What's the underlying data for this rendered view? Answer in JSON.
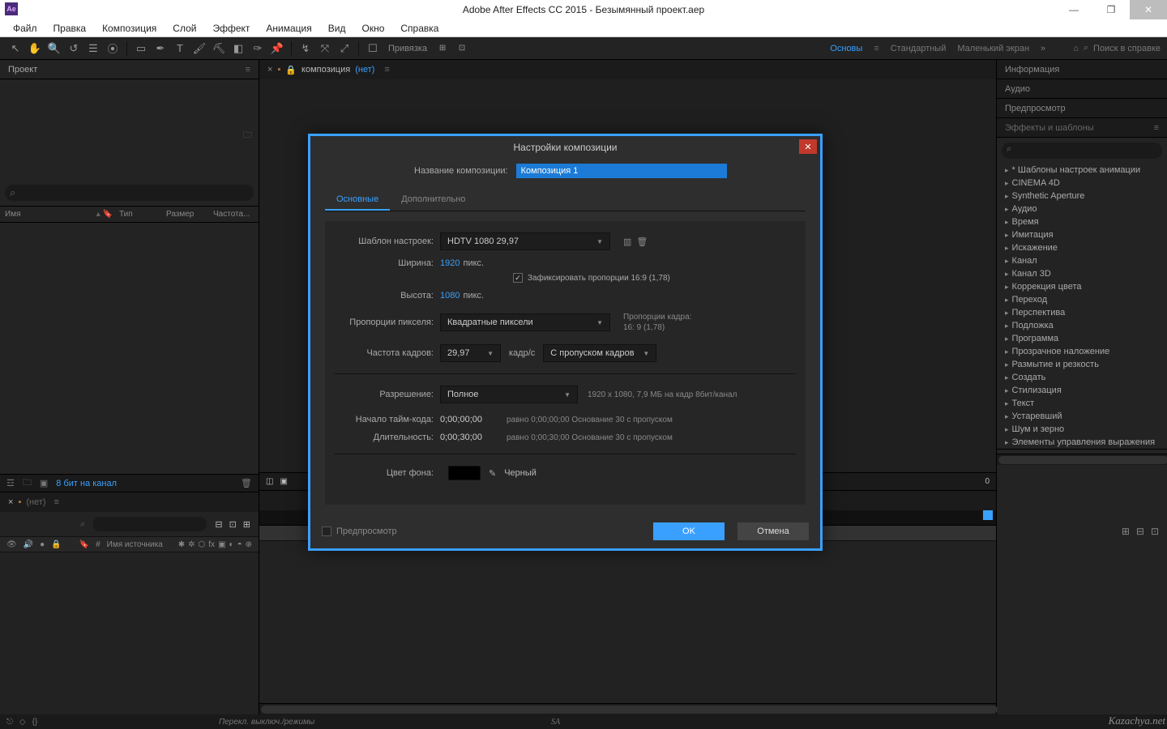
{
  "titlebar": {
    "title": "Adobe After Effects CC 2015 - Безымянный проект.aep",
    "icon_text": "Ae"
  },
  "menubar": [
    "Файл",
    "Правка",
    "Композиция",
    "Слой",
    "Эффект",
    "Анимация",
    "Вид",
    "Окно",
    "Справка"
  ],
  "toolbar": {
    "snap_label": "Привязка",
    "search_placeholder": "Поиск в справке"
  },
  "workspace": {
    "tabs": [
      "Основы",
      "Стандартный",
      "Маленький экран"
    ],
    "active": 0,
    "more": "»"
  },
  "project": {
    "title": "Проект",
    "cols": {
      "name": "Имя",
      "type": "Тип",
      "size": "Размер",
      "freq": "Частота..."
    },
    "footer_bits": "8 бит на канал"
  },
  "composition_panel": {
    "label": "композиция",
    "none": "(нет)"
  },
  "right_panels": {
    "info": "Информация",
    "audio": "Аудио",
    "preview": "Предпросмотр",
    "fx_title": "Эффекты и шаблоны",
    "fx_items": [
      "* Шаблоны настроек анимации",
      "CINEMA 4D",
      "Synthetic Aperture",
      "Аудио",
      "Время",
      "Имитация",
      "Искажение",
      "Канал",
      "Канал 3D",
      "Коррекция цвета",
      "Переход",
      "Перспектива",
      "Подложка",
      "Программа",
      "Прозрачное наложение",
      "Размытие и резкость",
      "Создать",
      "Стилизация",
      "Текст",
      "Устаревший",
      "Шум и зерно",
      "Элементы управления выражения"
    ]
  },
  "timeline": {
    "tab_none": "(нет)",
    "source_label": "Имя источника"
  },
  "dialog": {
    "title": "Настройки композиции",
    "name_label": "Название композиции:",
    "name_value": "Композиция 1",
    "tabs": [
      "Основные",
      "Дополнительно"
    ],
    "preset_label": "Шаблон настроек:",
    "preset_value": "HDTV 1080 29,97",
    "width_label": "Ширина:",
    "width_value": "1920",
    "height_label": "Высота:",
    "height_value": "1080",
    "px_unit": "пикс.",
    "lock_label": "Зафиксировать пропорции 16:9 (1,78)",
    "lock_checked": "✓",
    "par_label": "Пропорции пикселя:",
    "par_value": "Квадратные пиксели",
    "frame_ar_label": "Пропорции кадра:",
    "frame_ar_value": "16: 9 (1,78)",
    "fps_label": "Частота кадров:",
    "fps_value": "29,97",
    "fps_unit": "кадр/с",
    "fps_mode": "С пропуском кадров",
    "res_label": "Разрешение:",
    "res_value": "Полное",
    "res_hint": "1920 x 1080, 7,9 МБ на кадр 8бит/канал",
    "tc_label": "Начало тайм-кода:",
    "tc_value": "0;00;00;00",
    "tc_hint": "равно 0;00;00;00 Основание 30 с пропуском",
    "dur_label": "Длительность:",
    "dur_value": "0;00;30;00",
    "dur_hint": "равно 0;00;30;00 Основание 30 с пропуском",
    "bg_label": "Цвет фона:",
    "bg_name": "Черный",
    "preview_label": "Предпросмотр",
    "ok": "OK",
    "cancel": "Отмена"
  },
  "bottom": {
    "hint": "Перекл. выключ./режимы",
    "sa": "SA"
  },
  "watermark": "Kazachya.net",
  "comp_strip_right": "0"
}
